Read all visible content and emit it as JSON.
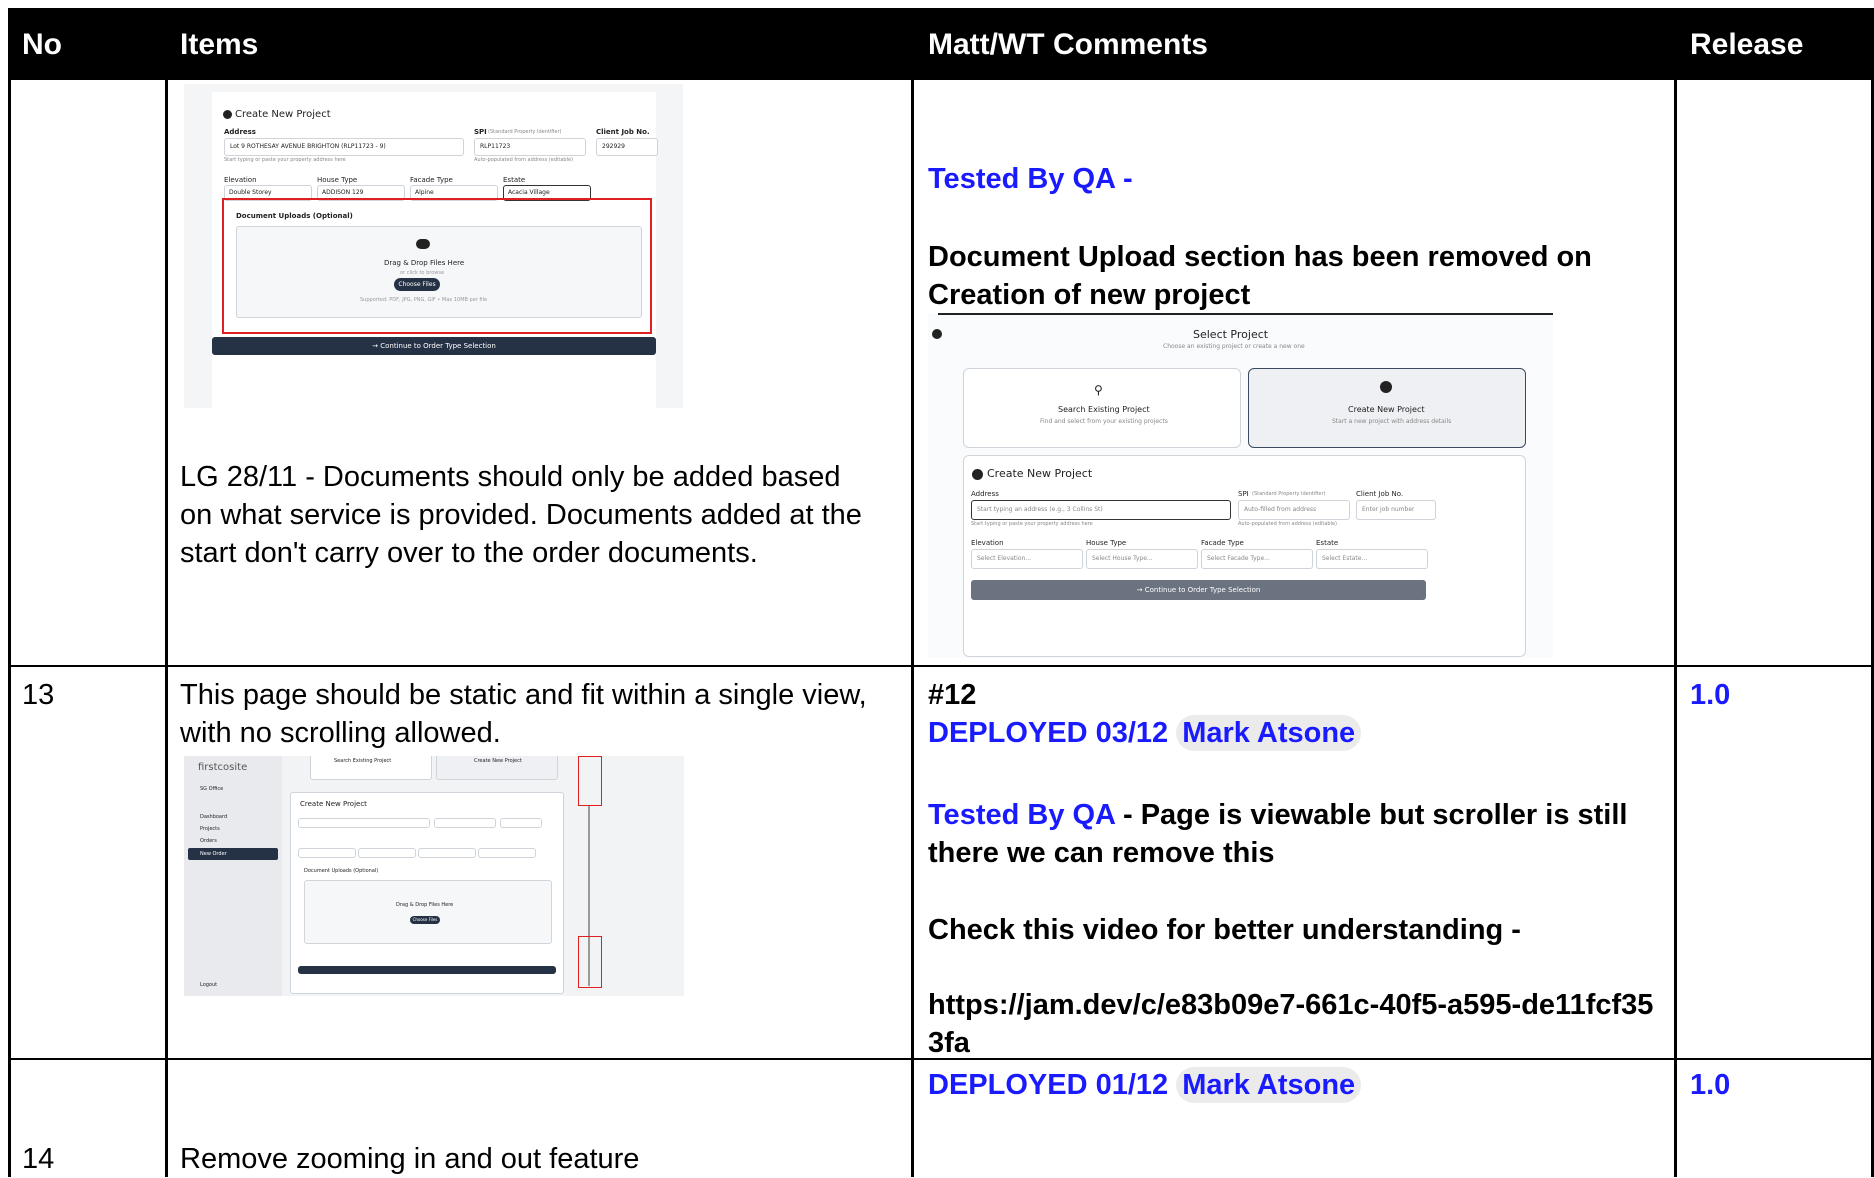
{
  "header": {
    "no": "No",
    "items": "Items",
    "comments": "Matt/WT Comments",
    "release": "Release"
  },
  "row12": {
    "item_note": "LG 28/11 - Documents should only be added based on what service is provided.  Documents added at the start don't carry over to the order documents.",
    "tested": "Tested By QA -",
    "comment": "Document Upload section has been removed on Creation of new project",
    "shot1": {
      "title": "Create New Project",
      "address_label": "Address",
      "address_value": "Lot 9 ROTHESAY AVENUE BRIGHTON (RLP11723 - 9)",
      "address_help": "Start typing or paste your property address here",
      "spi_label": "SPI",
      "spi_sub": "(Standard Property Identifier)",
      "spi_value": "RLP11723",
      "spi_help": "Auto-populated from address (editable)",
      "job_label": "Client Job No.",
      "job_value": "292929",
      "elevation_label": "Elevation",
      "elevation_value": "Double Storey",
      "house_label": "House Type",
      "house_value": "ADDISON 129",
      "facade_label": "Facade Type",
      "facade_value": "Alpine",
      "estate_label": "Estate",
      "estate_value": "Acacia Village",
      "uploads_title": "Document Uploads (Optional)",
      "drop_title": "Drag & Drop Files Here",
      "drop_sub": "or click to browse",
      "choose": "Choose Files",
      "supported": "Supported: PDF, JPG, PNG, GIF • Max 10MB per file",
      "continue": "→ Continue to Order Type Selection"
    },
    "shot2": {
      "title": "Select Project",
      "subtitle": "Choose an existing project or create a new one",
      "search_title": "Search Existing Project",
      "search_sub": "Find and select from your existing projects",
      "create_title": "Create New Project",
      "create_sub": "Start a new project with address details",
      "form_title": "Create New Project",
      "address_label": "Address",
      "address_placeholder": "Start typing an address (e.g., 3 Collins St)",
      "address_help": "Start typing or paste your property address here",
      "spi_label": "SPI",
      "spi_sub": "(Standard Property Identifier)",
      "spi_placeholder": "Auto-filled from address",
      "spi_help": "Auto-populated from address (editable)",
      "job_label": "Client Job No.",
      "job_placeholder": "Enter job number",
      "elevation_label": "Elevation",
      "elevation_placeholder": "Select Elevation...",
      "house_label": "House Type",
      "house_placeholder": "Select House Type...",
      "facade_label": "Facade Type",
      "facade_placeholder": "Select Facade Type...",
      "estate_label": "Estate",
      "estate_placeholder": "Select Estate...",
      "continue": "→ Continue to Order Type Selection"
    }
  },
  "row13": {
    "no": "13",
    "item": "This page should be static and fit within a single view, with no scrolling allowed.",
    "ref": "#12",
    "deployed": "DEPLOYED 03/12",
    "person": "Mark Atsone",
    "tested": "Tested By QA",
    "tested_rest": " - Page is viewable but scroller is still there we can remove this",
    "check": "Check this video for better understanding -",
    "link": "https://jam.dev/c/e83b09e7-661c-40f5-a595-de11fcf353fa",
    "release": "1.0",
    "shot3": {
      "logo": "firstcosite",
      "user": "SG Office",
      "nav": [
        "Dashboard",
        "Projects",
        "Orders",
        "New Order"
      ],
      "logout": "Logout",
      "search_title": "Search Existing Project",
      "create_title": "Create New Project",
      "form_title": "Create New Project",
      "uploads_title": "Document Uploads (Optional)",
      "drop_title": "Drag & Drop Files Here",
      "choose": "Choose Files"
    }
  },
  "row14": {
    "no": "14",
    "item": "Remove zooming in and out feature",
    "deployed": "DEPLOYED 01/12",
    "person": "Mark Atsone",
    "release": "1.0"
  }
}
